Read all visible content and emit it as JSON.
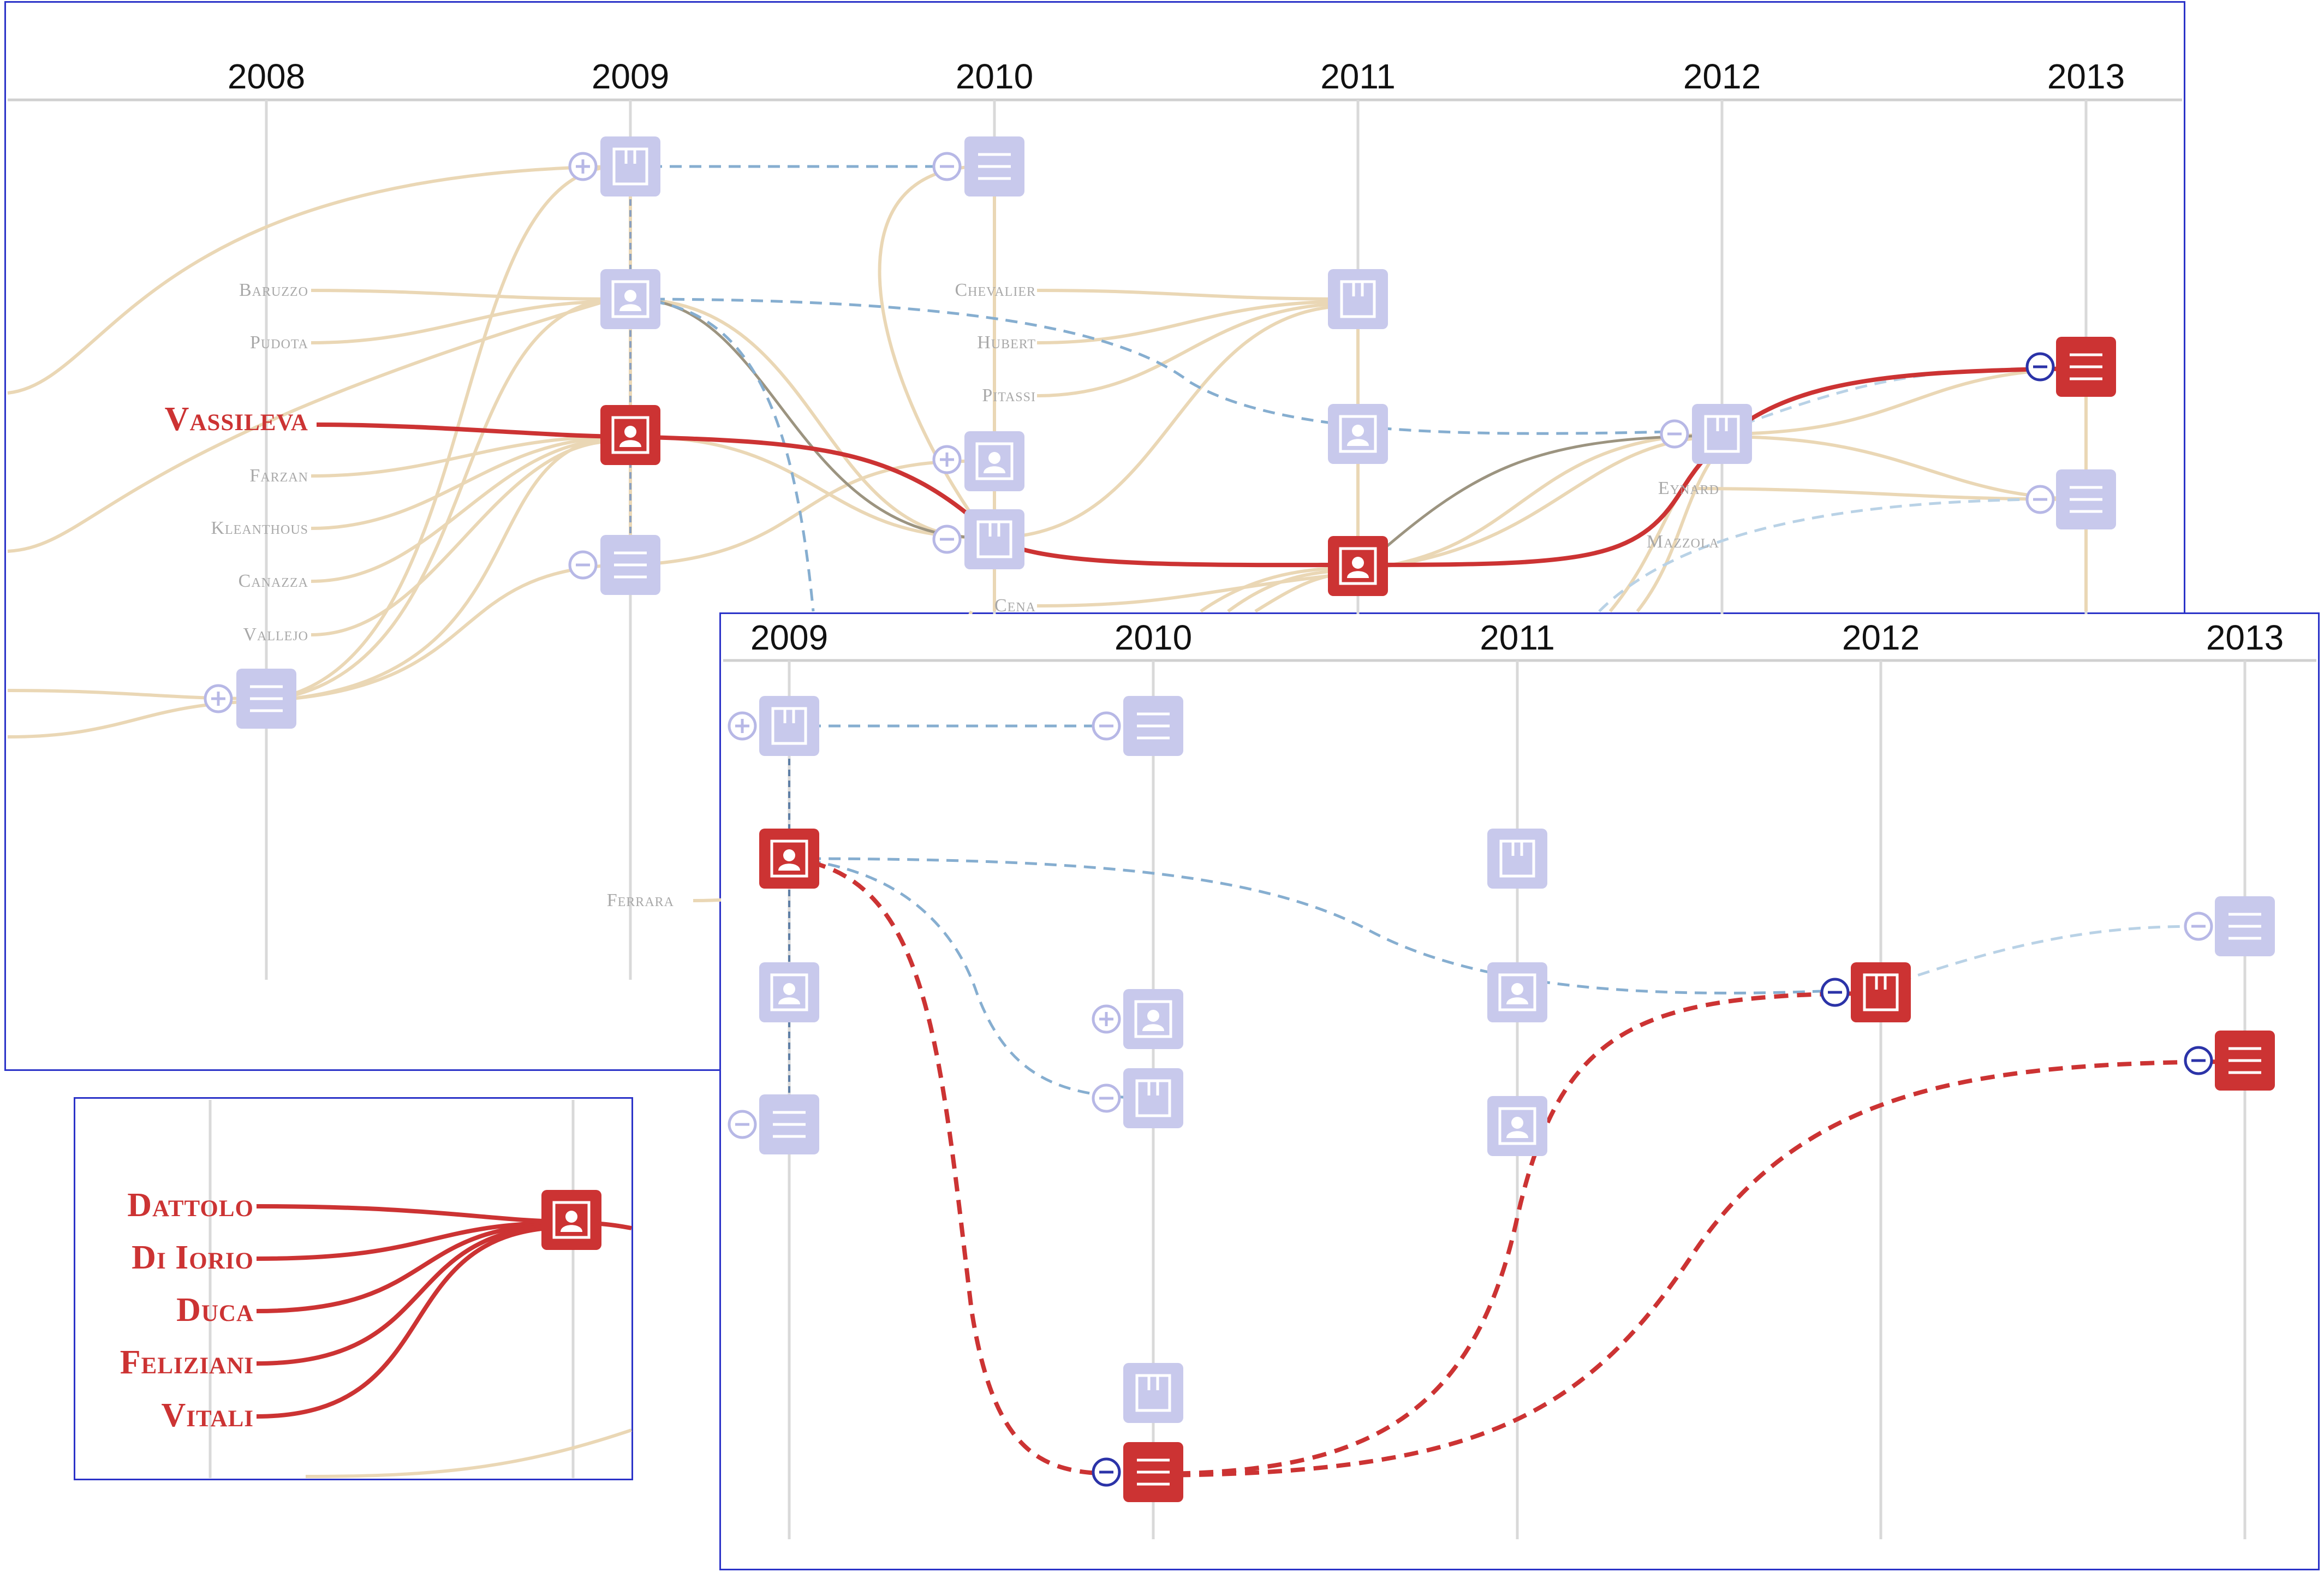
{
  "panel_main": {
    "years": [
      "2008",
      "2009",
      "2010",
      "2011",
      "2012",
      "2013"
    ],
    "authors": [
      "Baruzzo",
      "Pudota",
      "Vassileva",
      "Farzan",
      "Kleanthous",
      "Canazza",
      "Vallejo",
      "Chevalier",
      "Hubert",
      "Pitassi",
      "Cena",
      "Ferrara",
      "Eynard",
      "Mazzola"
    ],
    "highlighted_author": "Vassileva"
  },
  "panel_zoom": {
    "years": [
      "2009",
      "2010",
      "2011",
      "2012",
      "2013"
    ]
  },
  "panel_inset": {
    "authors": [
      "Dattolo",
      "Di Iorio",
      "Duca",
      "Feliziani",
      "Vitali"
    ]
  },
  "node_types": {
    "book": "book-icon",
    "person": "person-icon",
    "list": "list-icon"
  },
  "colors": {
    "highlight": "#cc3333",
    "node": "#c8c9ec",
    "author_line": "#ead7b5",
    "citation_dash": "#86aed0",
    "panel_border": "#2b33c8"
  }
}
